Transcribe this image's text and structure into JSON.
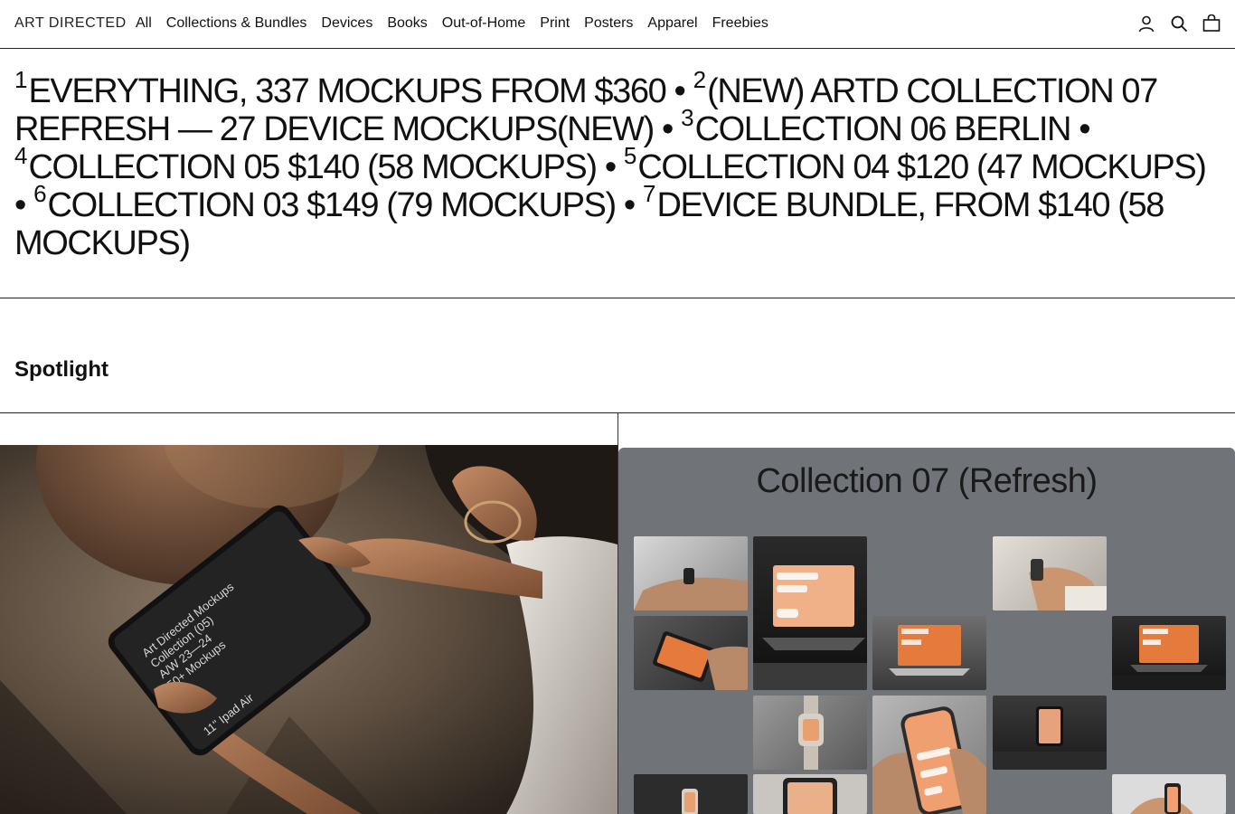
{
  "header": {
    "logo": "ART DIRECTED",
    "nav": [
      "All",
      "Collections & Bundles",
      "Devices",
      "Books",
      "Out-of-Home",
      "Print",
      "Posters",
      "Apparel",
      "Freebies"
    ],
    "icons": [
      "account-icon",
      "search-icon",
      "cart-icon"
    ]
  },
  "ticker": {
    "items": [
      {
        "num": "1",
        "text": "EVERYTHING, 337 MOCKUPS FROM $360"
      },
      {
        "num": "2",
        "text": "(NEW) ARTD COLLECTION 07 REFRESH — 27 DEVICE MOCKUPS(NEW)"
      },
      {
        "num": "3",
        "text": "COLLECTION 06 BERLIN"
      },
      {
        "num": "4",
        "text": "COLLECTION 05 $140 (58 MOCKUPS)"
      },
      {
        "num": "5",
        "text": "COLLECTION 04 $120 (47 MOCKUPS)"
      },
      {
        "num": "6",
        "text": "COLLECTION 03 $149 (79 MOCKUPS)"
      },
      {
        "num": "7",
        "text": "DEVICE BUNDLE, FROM $140 (58 MOCKUPS)"
      }
    ],
    "separator": "•"
  },
  "spotlight": {
    "title": "Spotlight"
  },
  "cards": {
    "left": {
      "tablet_text": [
        "Art Directed Mockups",
        "Collection (05)",
        "A/W 23—24",
        "50+ Mockups"
      ],
      "tablet_model": "11\" Ipad Air"
    },
    "right": {
      "title": "Collection 07 (Refresh)"
    }
  },
  "colors": {
    "text": "#111111",
    "border": "#222222",
    "right_card_bg": "#707479",
    "left_card_bg": "#3a332c",
    "accent_orange": "#e47a3c"
  }
}
